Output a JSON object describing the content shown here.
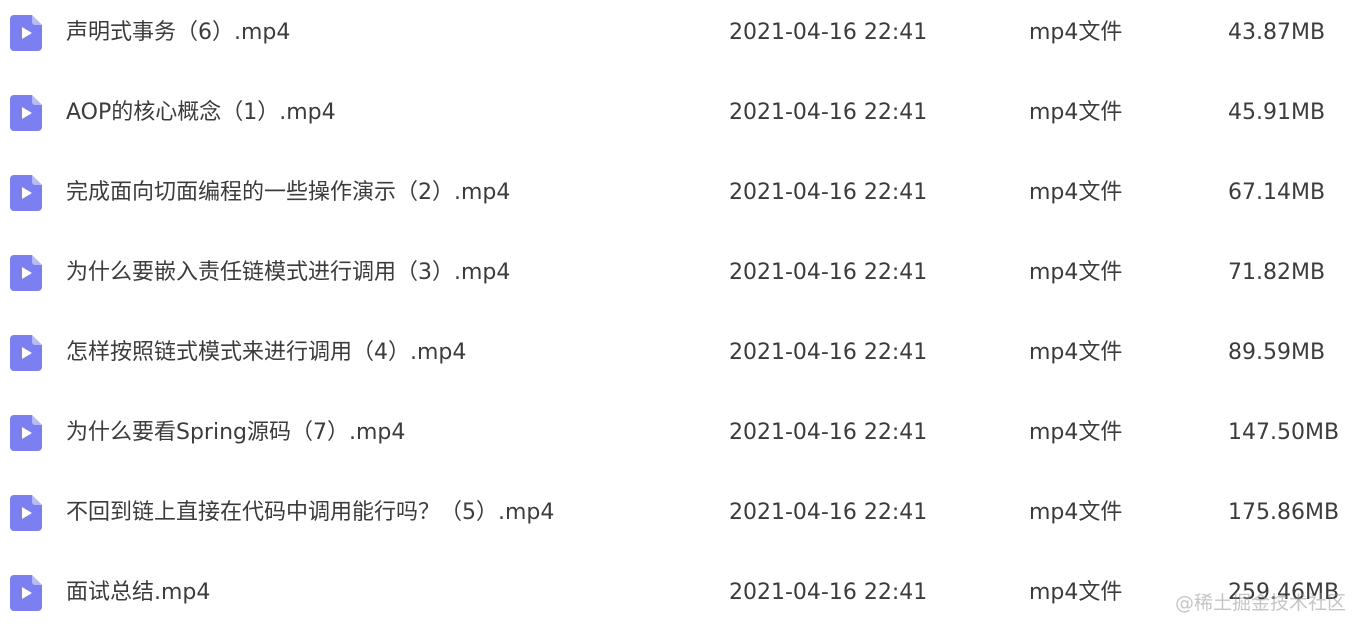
{
  "files": [
    {
      "name": "声明式事务（6）.mp4",
      "modified": "2021-04-16 22:41",
      "type": "mp4文件",
      "size": "43.87MB"
    },
    {
      "name": "AOP的核心概念（1）.mp4",
      "modified": "2021-04-16 22:41",
      "type": "mp4文件",
      "size": "45.91MB"
    },
    {
      "name": "完成面向切面编程的一些操作演示（2）.mp4",
      "modified": "2021-04-16 22:41",
      "type": "mp4文件",
      "size": "67.14MB"
    },
    {
      "name": "为什么要嵌入责任链模式进行调用（3）.mp4",
      "modified": "2021-04-16 22:41",
      "type": "mp4文件",
      "size": "71.82MB"
    },
    {
      "name": "怎样按照链式模式来进行调用（4）.mp4",
      "modified": "2021-04-16 22:41",
      "type": "mp4文件",
      "size": "89.59MB"
    },
    {
      "name": "为什么要看Spring源码（7）.mp4",
      "modified": "2021-04-16 22:41",
      "type": "mp4文件",
      "size": "147.50MB"
    },
    {
      "name": "不回到链上直接在代码中调用能行吗？（5）.mp4",
      "modified": "2021-04-16 22:41",
      "type": "mp4文件",
      "size": "175.86MB"
    },
    {
      "name": "面试总结.mp4",
      "modified": "2021-04-16 22:41",
      "type": "mp4文件",
      "size": "259.46MB"
    }
  ],
  "icon": {
    "name": "video-file-icon",
    "color": "#7b7ff0",
    "fold_color": "#b9bbf7"
  },
  "watermark": "@稀土掘金技术社区"
}
